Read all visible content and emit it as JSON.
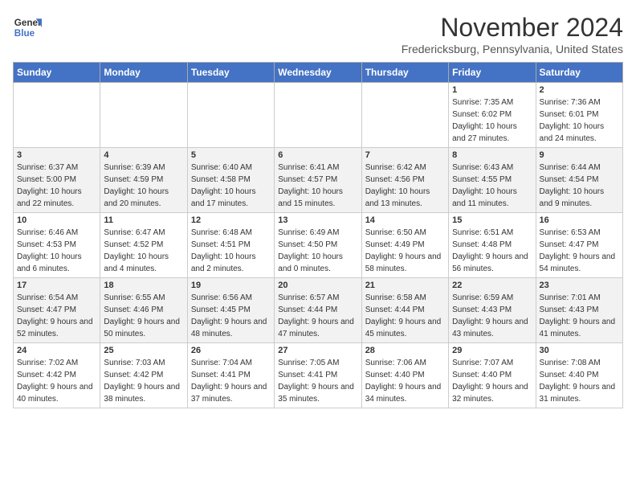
{
  "logo": {
    "line1": "General",
    "line2": "Blue"
  },
  "title": "November 2024",
  "location": "Fredericksburg, Pennsylvania, United States",
  "weekdays": [
    "Sunday",
    "Monday",
    "Tuesday",
    "Wednesday",
    "Thursday",
    "Friday",
    "Saturday"
  ],
  "weeks": [
    [
      {
        "day": "",
        "info": ""
      },
      {
        "day": "",
        "info": ""
      },
      {
        "day": "",
        "info": ""
      },
      {
        "day": "",
        "info": ""
      },
      {
        "day": "",
        "info": ""
      },
      {
        "day": "1",
        "info": "Sunrise: 7:35 AM\nSunset: 6:02 PM\nDaylight: 10 hours and 27 minutes."
      },
      {
        "day": "2",
        "info": "Sunrise: 7:36 AM\nSunset: 6:01 PM\nDaylight: 10 hours and 24 minutes."
      }
    ],
    [
      {
        "day": "3",
        "info": "Sunrise: 6:37 AM\nSunset: 5:00 PM\nDaylight: 10 hours and 22 minutes."
      },
      {
        "day": "4",
        "info": "Sunrise: 6:39 AM\nSunset: 4:59 PM\nDaylight: 10 hours and 20 minutes."
      },
      {
        "day": "5",
        "info": "Sunrise: 6:40 AM\nSunset: 4:58 PM\nDaylight: 10 hours and 17 minutes."
      },
      {
        "day": "6",
        "info": "Sunrise: 6:41 AM\nSunset: 4:57 PM\nDaylight: 10 hours and 15 minutes."
      },
      {
        "day": "7",
        "info": "Sunrise: 6:42 AM\nSunset: 4:56 PM\nDaylight: 10 hours and 13 minutes."
      },
      {
        "day": "8",
        "info": "Sunrise: 6:43 AM\nSunset: 4:55 PM\nDaylight: 10 hours and 11 minutes."
      },
      {
        "day": "9",
        "info": "Sunrise: 6:44 AM\nSunset: 4:54 PM\nDaylight: 10 hours and 9 minutes."
      }
    ],
    [
      {
        "day": "10",
        "info": "Sunrise: 6:46 AM\nSunset: 4:53 PM\nDaylight: 10 hours and 6 minutes."
      },
      {
        "day": "11",
        "info": "Sunrise: 6:47 AM\nSunset: 4:52 PM\nDaylight: 10 hours and 4 minutes."
      },
      {
        "day": "12",
        "info": "Sunrise: 6:48 AM\nSunset: 4:51 PM\nDaylight: 10 hours and 2 minutes."
      },
      {
        "day": "13",
        "info": "Sunrise: 6:49 AM\nSunset: 4:50 PM\nDaylight: 10 hours and 0 minutes."
      },
      {
        "day": "14",
        "info": "Sunrise: 6:50 AM\nSunset: 4:49 PM\nDaylight: 9 hours and 58 minutes."
      },
      {
        "day": "15",
        "info": "Sunrise: 6:51 AM\nSunset: 4:48 PM\nDaylight: 9 hours and 56 minutes."
      },
      {
        "day": "16",
        "info": "Sunrise: 6:53 AM\nSunset: 4:47 PM\nDaylight: 9 hours and 54 minutes."
      }
    ],
    [
      {
        "day": "17",
        "info": "Sunrise: 6:54 AM\nSunset: 4:47 PM\nDaylight: 9 hours and 52 minutes."
      },
      {
        "day": "18",
        "info": "Sunrise: 6:55 AM\nSunset: 4:46 PM\nDaylight: 9 hours and 50 minutes."
      },
      {
        "day": "19",
        "info": "Sunrise: 6:56 AM\nSunset: 4:45 PM\nDaylight: 9 hours and 48 minutes."
      },
      {
        "day": "20",
        "info": "Sunrise: 6:57 AM\nSunset: 4:44 PM\nDaylight: 9 hours and 47 minutes."
      },
      {
        "day": "21",
        "info": "Sunrise: 6:58 AM\nSunset: 4:44 PM\nDaylight: 9 hours and 45 minutes."
      },
      {
        "day": "22",
        "info": "Sunrise: 6:59 AM\nSunset: 4:43 PM\nDaylight: 9 hours and 43 minutes."
      },
      {
        "day": "23",
        "info": "Sunrise: 7:01 AM\nSunset: 4:43 PM\nDaylight: 9 hours and 41 minutes."
      }
    ],
    [
      {
        "day": "24",
        "info": "Sunrise: 7:02 AM\nSunset: 4:42 PM\nDaylight: 9 hours and 40 minutes."
      },
      {
        "day": "25",
        "info": "Sunrise: 7:03 AM\nSunset: 4:42 PM\nDaylight: 9 hours and 38 minutes."
      },
      {
        "day": "26",
        "info": "Sunrise: 7:04 AM\nSunset: 4:41 PM\nDaylight: 9 hours and 37 minutes."
      },
      {
        "day": "27",
        "info": "Sunrise: 7:05 AM\nSunset: 4:41 PM\nDaylight: 9 hours and 35 minutes."
      },
      {
        "day": "28",
        "info": "Sunrise: 7:06 AM\nSunset: 4:40 PM\nDaylight: 9 hours and 34 minutes."
      },
      {
        "day": "29",
        "info": "Sunrise: 7:07 AM\nSunset: 4:40 PM\nDaylight: 9 hours and 32 minutes."
      },
      {
        "day": "30",
        "info": "Sunrise: 7:08 AM\nSunset: 4:40 PM\nDaylight: 9 hours and 31 minutes."
      }
    ]
  ]
}
